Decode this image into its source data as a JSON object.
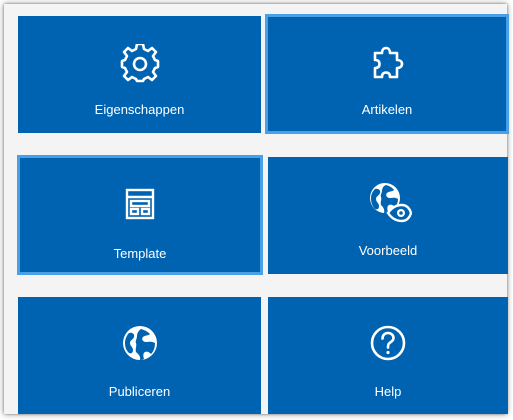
{
  "colors": {
    "tile": "#0063b1",
    "selected_border": "#4aa0e6",
    "background": "#f4f4f4"
  },
  "tiles": [
    {
      "label": "Eigenschappen",
      "icon": "gear-icon",
      "selected": false
    },
    {
      "label": "Artikelen",
      "icon": "puzzle-piece-icon",
      "selected": true
    },
    {
      "label": "Template",
      "icon": "layout-template-icon",
      "selected": true
    },
    {
      "label": "Voorbeeld",
      "icon": "globe-eye-icon",
      "selected": false
    },
    {
      "label": "Publiceren",
      "icon": "globe-icon",
      "selected": false
    },
    {
      "label": "Help",
      "icon": "question-circle-icon",
      "selected": false
    }
  ]
}
